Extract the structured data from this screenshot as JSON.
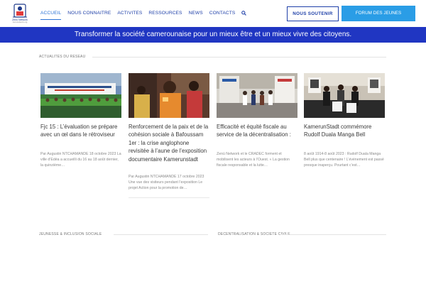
{
  "header": {
    "logo": {
      "name": "Zenü Network",
      "subtitle": "zenunetwork.org",
      "icon": "building-icon"
    },
    "nav": [
      {
        "label": "ACCUEIL",
        "active": true
      },
      {
        "label": "NOUS CONNAITRE",
        "active": false
      },
      {
        "label": "ACTIVITES",
        "active": false
      },
      {
        "label": "RESSOURCES",
        "active": false
      },
      {
        "label": "NEWS",
        "active": false
      },
      {
        "label": "CONTACTS",
        "active": false
      }
    ],
    "search_icon": "search-icon",
    "cta_support": "NOUS SOUTENIR",
    "cta_forum": "FORUM DES JEUNES"
  },
  "banner": {
    "text": "Transformer la société camerounaise pour un mieux être et un mieux vivre des citoyens."
  },
  "sections": {
    "news": "ACTUALITES DU RESEAU",
    "youth": "JEUNESSE & INCLUSION SOCIALE",
    "decentralisation": "DECENTRALISATION & SOCIETE CIVILE"
  },
  "articles": [
    {
      "title": "Fjc 15 : L’évaluation se prépare avec un œl dans le rétroviseur",
      "meta": "Par Augustin NTCHAMANDE 18 octobre 2023 La ville d’Edéa a accueilli du 16 au 18 août dernier, la quinzième…"
    },
    {
      "title": "Renforcement de la paix et de la cohésion sociale à Bafoussam 1er : la crise anglophone revisitée à l’aune de l’exposition documentaire Kamerunstadt",
      "meta": "Par Augustin NTCHAMANDE 17 octobre 2023 Une vue des visiteurs pendant l’exposition Le projet Action pour la promotion de…"
    },
    {
      "title": "Efficacité et équité fiscale au service de la décentralisation :",
      "meta": "Zenü Network et le CRADEC forment et mobilisent les acteurs à l’Ouest. « La gestion fiscale responsable et la lutte…"
    },
    {
      "title": "KamerunStadt commémore Rudolf Duala Manga Bell",
      "meta": "8 août 1914-8 août 2023 : Rudolf Duala Manga Bell plus que centenaire ! L’évènement est passé presque inaperçu. Pourtant c’est…"
    }
  ],
  "colors": {
    "brand": "#1e3fa8",
    "banner": "#2036c2",
    "forum": "#2a9de6"
  }
}
